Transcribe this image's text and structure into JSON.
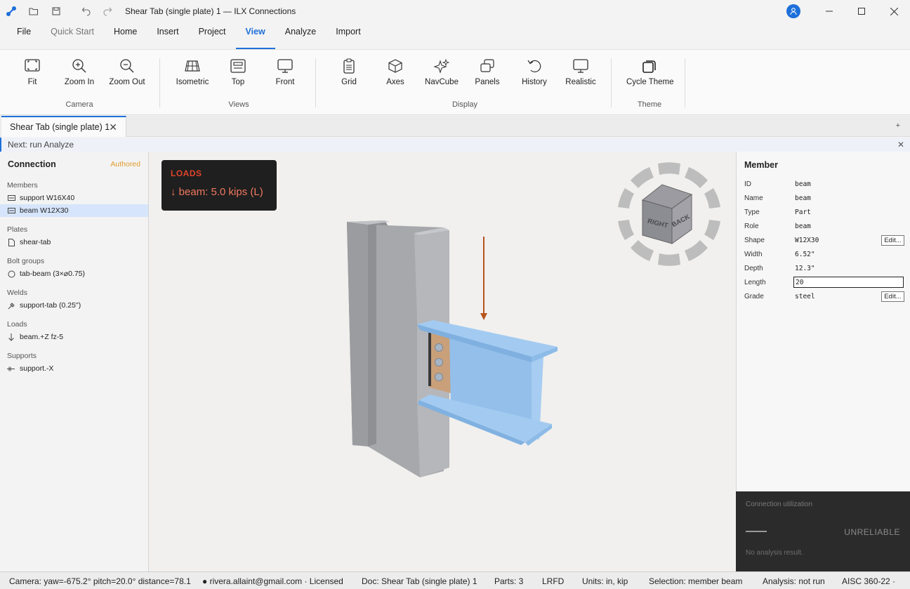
{
  "window": {
    "title": "Shear Tab (single plate) 1 — ILX Connections"
  },
  "menu": [
    "File",
    "Quick Start",
    "Home",
    "Insert",
    "Project",
    "View",
    "Analyze",
    "Import"
  ],
  "ribbon": {
    "camera": {
      "label": "Camera",
      "fit": "Fit",
      "zoom_in": "Zoom In",
      "zoom_out": "Zoom Out"
    },
    "views": {
      "label": "Views",
      "isometric": "Isometric",
      "top": "Top",
      "front": "Front"
    },
    "display": {
      "label": "Display",
      "grid": "Grid",
      "axes": "Axes",
      "navcube": "NavCube",
      "panels": "Panels",
      "history": "History",
      "realistic": "Realistic"
    },
    "theme": {
      "label": "Theme",
      "cycle_theme": "Cycle Theme"
    }
  },
  "doc_tab": {
    "label": "Shear Tab (single plate) 1",
    "close": "✕",
    "new": "+"
  },
  "hint": {
    "text": "Next: run Analyze",
    "close": "✕"
  },
  "connection": {
    "title": "Connection",
    "badge": "Authored",
    "members_label": "Members",
    "member_support": "support  W16X40",
    "member_beam": "beam  W12X30",
    "plates_label": "Plates",
    "plate_shear_tab": "shear-tab",
    "bolt_groups_label": "Bolt groups",
    "bolt_tab_beam": "tab-beam (3×⌀0.75)",
    "welds_label": "Welds",
    "weld_support_tab": "support-tab (0.25\")",
    "loads_label": "Loads",
    "load_beam": "beam.+Z  fz-5",
    "supports_label": "Supports",
    "support_x": "support.-X"
  },
  "loads_card": {
    "title": "LOADS",
    "line": "↓ beam:  5.0 kips  (L)"
  },
  "navcube": {
    "right": "RIGHT",
    "back": "BACK"
  },
  "member": {
    "title": "Member",
    "id_key": "ID",
    "id_val": "beam",
    "name_key": "Name",
    "name_val": "beam",
    "type_key": "Type",
    "type_val": "Part",
    "role_key": "Role",
    "role_val": "beam",
    "shape_key": "Shape",
    "shape_val": "W12X30",
    "width_key": "Width",
    "width_val": "6.52\"",
    "depth_key": "Depth",
    "depth_val": "12.3\"",
    "length_key": "Length",
    "length_val": "20",
    "grade_key": "Grade",
    "grade_val": "steel",
    "edit_label": "Edit..."
  },
  "utilization": {
    "title": "Connection utilization",
    "status": "UNRELIABLE",
    "note": "No analysis result."
  },
  "statusbar": {
    "camera": "Camera: yaw=-675.2° pitch=20.0° distance=78.1",
    "user": "● rivera.allaint@gmail.com · Licensed",
    "doc": "Doc: Shear Tab (single plate) 1",
    "parts": "Parts: 3",
    "method": "LRFD",
    "units": "Units: in, kip",
    "selection": "Selection: member beam",
    "analysis": "Analysis: not run",
    "code": "AISC 360-22  ·"
  },
  "colors": {
    "accent": "#1e6fd9",
    "beam": "#9dc6ee",
    "column": "#a9abae",
    "plate": "#c9a07a",
    "load_arrow": "#b5541c",
    "loads_title": "#e0442a",
    "authored_badge": "#e29b2b"
  }
}
